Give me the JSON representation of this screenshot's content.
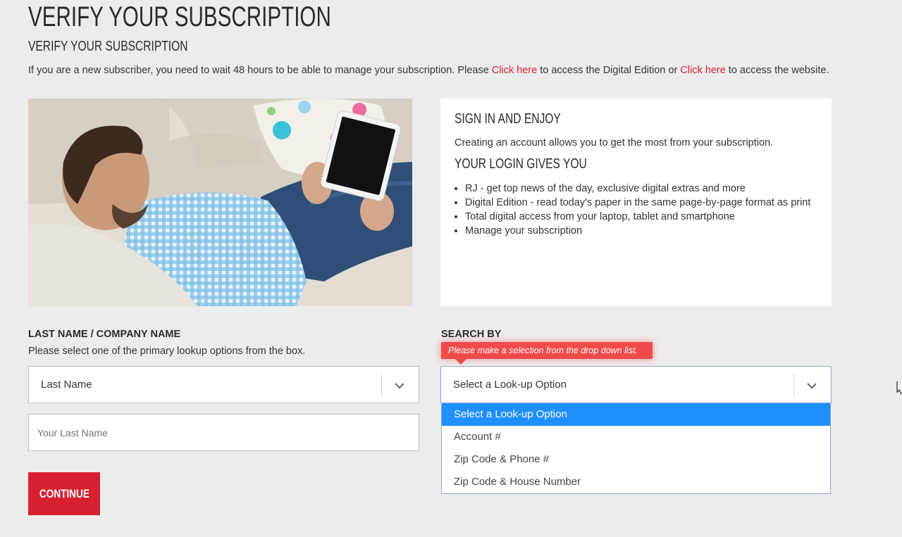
{
  "page": {
    "title": "VERIFY YOUR SUBSCRIPTION",
    "subtitle": "VERIFY YOUR SUBSCRIPTION",
    "intro": {
      "text1": "If you are a new subscriber, you need to wait 48 hours to be able to manage your subscription. Please ",
      "link1": "Click here",
      "text2": " to access the Digital Edition or ",
      "link2": "Click here",
      "text3": " to access the website."
    }
  },
  "panel": {
    "heading1": "SIGN IN AND ENJOY",
    "text": "Creating an account allows you to get the most from your subscription.",
    "heading2": "YOUR LOGIN GIVES YOU",
    "items": [
      "RJ - get top news of the day, exclusive digital extras and more",
      "Digital Edition - read today's paper in the same page-by-page format as print",
      "Total digital access from your laptop, tablet and smartphone",
      "Manage your subscription"
    ]
  },
  "form": {
    "lastname_label": "LAST NAME / COMPANY NAME",
    "help_text": "Please select one of the primary lookup options from the box.",
    "lastname_select_value": "Last Name",
    "lastname_placeholder": "Your Last Name",
    "search_by_label": "SEARCH BY",
    "tooltip": "Please make a selection from the drop down list.",
    "search_select_value": "Select a Look-up Option",
    "options": [
      "Select a Look-up Option",
      "Account #",
      "Zip Code & Phone #",
      "Zip Code & House Number"
    ],
    "continue_label": "CONTINUE"
  },
  "colors": {
    "accent": "#d62030",
    "selected_option": "#1e90ff",
    "tooltip": "#f04a4a",
    "background": "#ececec"
  }
}
